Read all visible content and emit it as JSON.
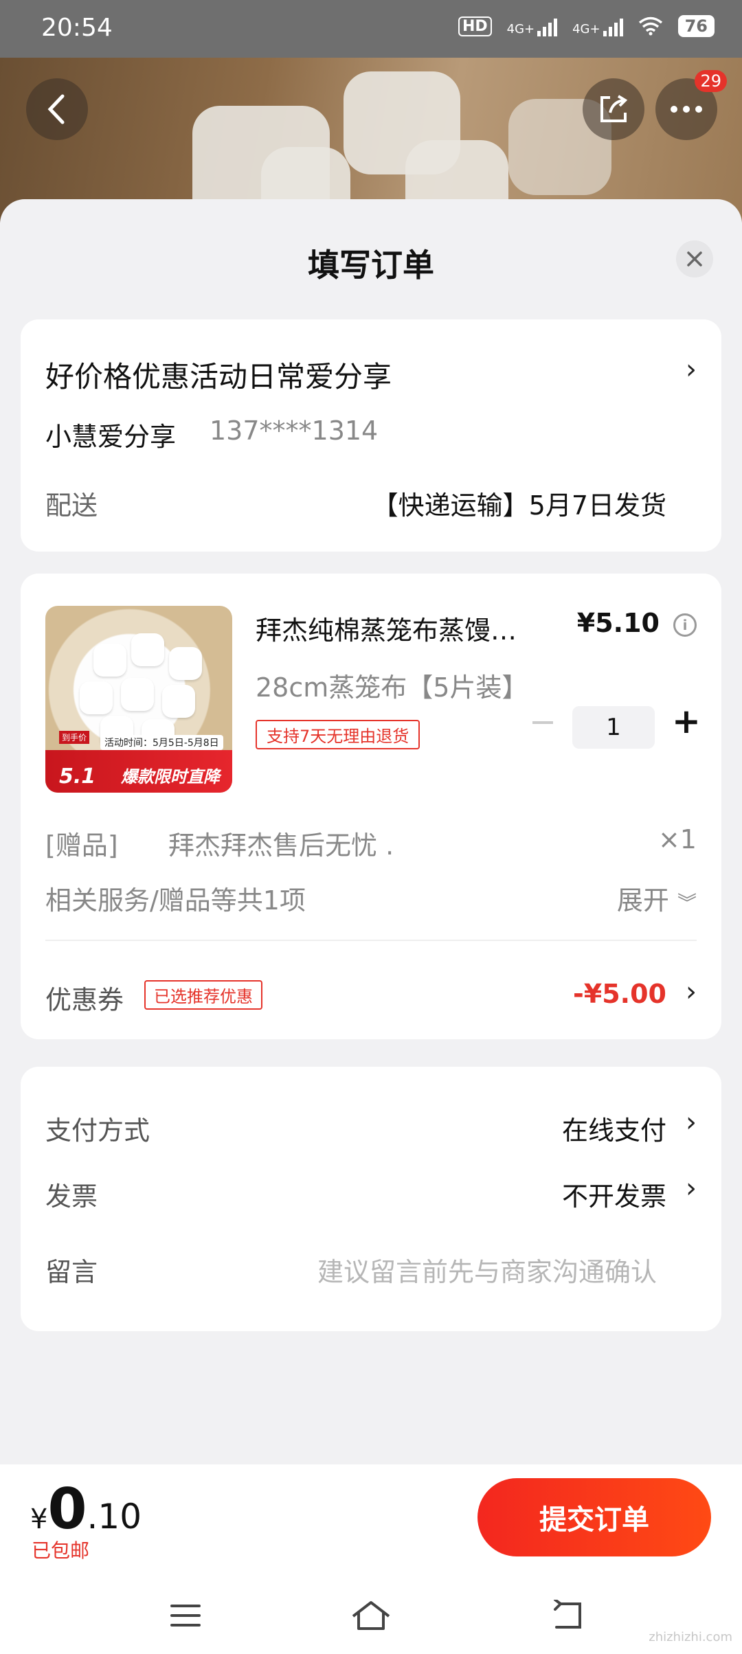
{
  "status_bar": {
    "time": "20:54",
    "signal_1": "4G+",
    "signal_2": "4G+",
    "hd_label": "HD",
    "battery": "76"
  },
  "hero": {
    "more_badge": "29"
  },
  "sheet": {
    "title": "填写订单"
  },
  "address": {
    "title": "好价格优惠活动日常爱分享",
    "name": "小慧爱分享",
    "phone": "137****1314",
    "shipping_label": "配送",
    "shipping_value": "【快递运输】5月7日发货"
  },
  "goods": {
    "name": "拜杰纯棉蒸笼布蒸馒…",
    "price": "¥5.10",
    "spec": "28cm蒸笼布【5片装】",
    "return_tag": "支持7天无理由退货",
    "quantity": "1",
    "promo_date": "5.1",
    "promo_text": "爆款限时直降",
    "promo_sub": "活动时间：5月5日-5月8日",
    "promo_pre": "到手价",
    "gift_label": "[赠品]",
    "gift_name": "拜杰拜杰售后无忧 .",
    "gift_qty": "×1",
    "services_label": "相关服务/赠品等共1项",
    "services_expand": "展开"
  },
  "coupon": {
    "label": "优惠券",
    "tag": "已选推荐优惠",
    "value": "-¥5.00"
  },
  "payment": {
    "method_label": "支付方式",
    "method_value": "在线支付",
    "invoice_label": "发票",
    "invoice_value": "不开发票",
    "message_label": "留言",
    "message_placeholder": "建议留言前先与商家沟通确认"
  },
  "bottom": {
    "currency": "¥",
    "total_int": "0",
    "total_dec": ".10",
    "free_shipping": "已包邮",
    "submit_label": "提交订单"
  },
  "watermark": "zhizhizhi.com",
  "colors": {
    "accent": "#e5332a",
    "submit_start": "#f3271f",
    "submit_end": "#ff4a14"
  }
}
